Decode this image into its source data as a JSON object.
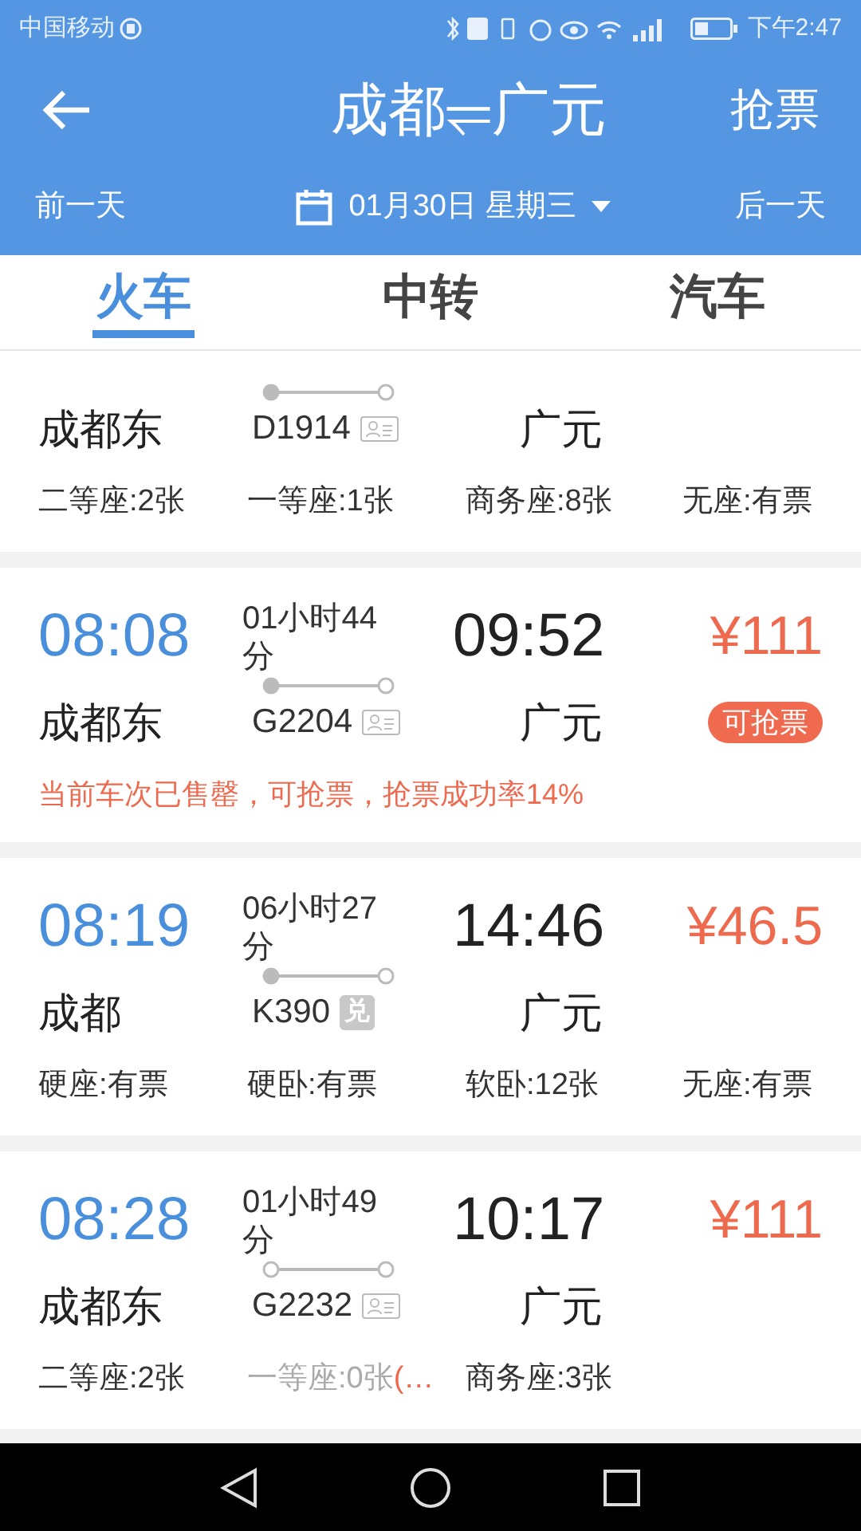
{
  "status_bar": {
    "carrier": "中国移动",
    "time": "下午2:47"
  },
  "header": {
    "title": "成都⥫广元",
    "action": "抢票"
  },
  "date_bar": {
    "prev": "前一天",
    "date": "01月30日 星期三",
    "next": "后一天"
  },
  "tabs": [
    {
      "label": "火车",
      "selected": true
    },
    {
      "label": "中转",
      "selected": false
    },
    {
      "label": "汽车",
      "selected": false
    }
  ],
  "trains": [
    {
      "from": "成都东",
      "train": "D1914",
      "tag": {
        "kind": "id"
      },
      "origin": true,
      "to": "广元",
      "seats": [
        {
          "label": "二等座:2张",
          "available": true
        },
        {
          "label": "一等座:1张",
          "available": true
        },
        {
          "label": "商务座:8张",
          "available": true
        },
        {
          "label": "无座:有票",
          "available": true
        }
      ]
    },
    {
      "depart": "08:08",
      "duration": "01小时44分",
      "arrive": "09:52",
      "price": "¥111",
      "from": "成都东",
      "train": "G2204",
      "tag": {
        "kind": "id"
      },
      "origin": true,
      "to": "广元",
      "badge": "可抢票",
      "notice": "当前车次已售罄，可抢票，抢票成功率14%"
    },
    {
      "depart": "08:19",
      "duration": "06小时27分",
      "arrive": "14:46",
      "price": "¥46.5",
      "from": "成都",
      "train": "K390",
      "tag": {
        "kind": "text",
        "text": "兑"
      },
      "origin": true,
      "to": "广元",
      "seats": [
        {
          "label": "硬座:有票",
          "available": true
        },
        {
          "label": "硬卧:有票",
          "available": true
        },
        {
          "label": "软卧:12张",
          "available": true
        },
        {
          "label": "无座:有票",
          "available": true
        }
      ]
    },
    {
      "depart": "08:28",
      "duration": "01小时49分",
      "arrive": "10:17",
      "price": "¥111",
      "from": "成都东",
      "train": "G2232",
      "tag": {
        "kind": "id"
      },
      "origin": false,
      "to": "广元",
      "seats": [
        {
          "label": "二等座:2张",
          "available": true
        },
        {
          "label": "一等座:0张",
          "note": "(…",
          "available": false
        },
        {
          "label": "商务座:3张",
          "available": true
        }
      ]
    }
  ]
}
